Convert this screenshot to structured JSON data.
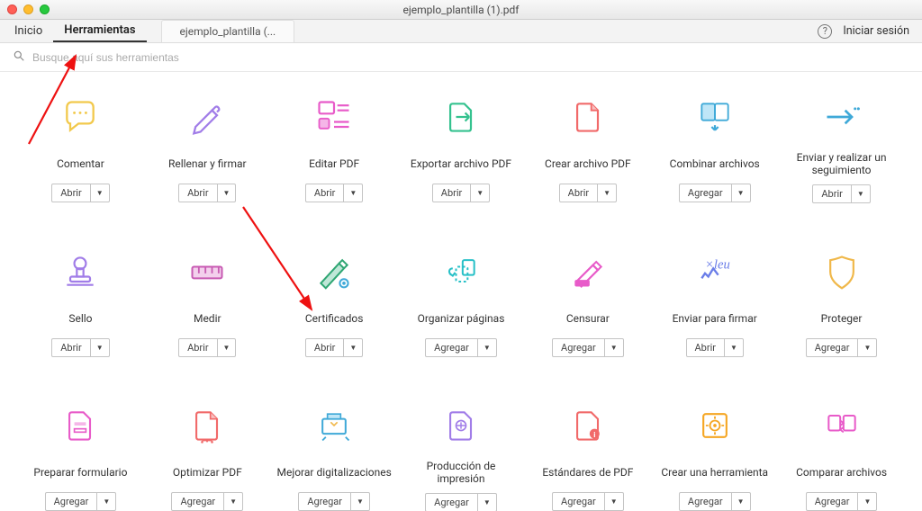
{
  "window": {
    "title": "ejemplo_plantilla (1).pdf"
  },
  "tabs": {
    "home": "Inicio",
    "tools": "Herramientas",
    "doc": "ejemplo_plantilla (..."
  },
  "header": {
    "signin": "Iniciar sesión"
  },
  "search": {
    "placeholder": "Busque aquí sus herramientas"
  },
  "buttons": {
    "open": "Abrir",
    "add": "Agregar"
  },
  "tools": [
    {
      "id": "comentar",
      "label": "Comentar",
      "btn": "open"
    },
    {
      "id": "rellenar",
      "label": "Rellenar y firmar",
      "btn": "open"
    },
    {
      "id": "editar",
      "label": "Editar PDF",
      "btn": "open"
    },
    {
      "id": "exportar",
      "label": "Exportar archivo PDF",
      "btn": "open"
    },
    {
      "id": "crear",
      "label": "Crear archivo PDF",
      "btn": "open"
    },
    {
      "id": "combinar",
      "label": "Combinar archivos",
      "btn": "add"
    },
    {
      "id": "enviar-seguimiento",
      "label": "Enviar y realizar un seguimiento",
      "btn": "open"
    },
    {
      "id": "sello",
      "label": "Sello",
      "btn": "open"
    },
    {
      "id": "medir",
      "label": "Medir",
      "btn": "open"
    },
    {
      "id": "certificados",
      "label": "Certificados",
      "btn": "open"
    },
    {
      "id": "organizar",
      "label": "Organizar páginas",
      "btn": "add"
    },
    {
      "id": "censurar",
      "label": "Censurar",
      "btn": "add"
    },
    {
      "id": "enviar-firmar",
      "label": "Enviar para firmar",
      "btn": "open"
    },
    {
      "id": "proteger",
      "label": "Proteger",
      "btn": "add"
    },
    {
      "id": "preparar",
      "label": "Preparar formulario",
      "btn": "add"
    },
    {
      "id": "optimizar",
      "label": "Optimizar PDF",
      "btn": "add"
    },
    {
      "id": "mejorar",
      "label": "Mejorar digitalizaciones",
      "btn": "add"
    },
    {
      "id": "produccion",
      "label": "Producción de impresión",
      "btn": "add"
    },
    {
      "id": "estandares",
      "label": "Estándares de PDF",
      "btn": "add"
    },
    {
      "id": "crear-herramienta",
      "label": "Crear una herramienta",
      "btn": "add"
    },
    {
      "id": "comparar",
      "label": "Comparar archivos",
      "btn": "add"
    }
  ]
}
